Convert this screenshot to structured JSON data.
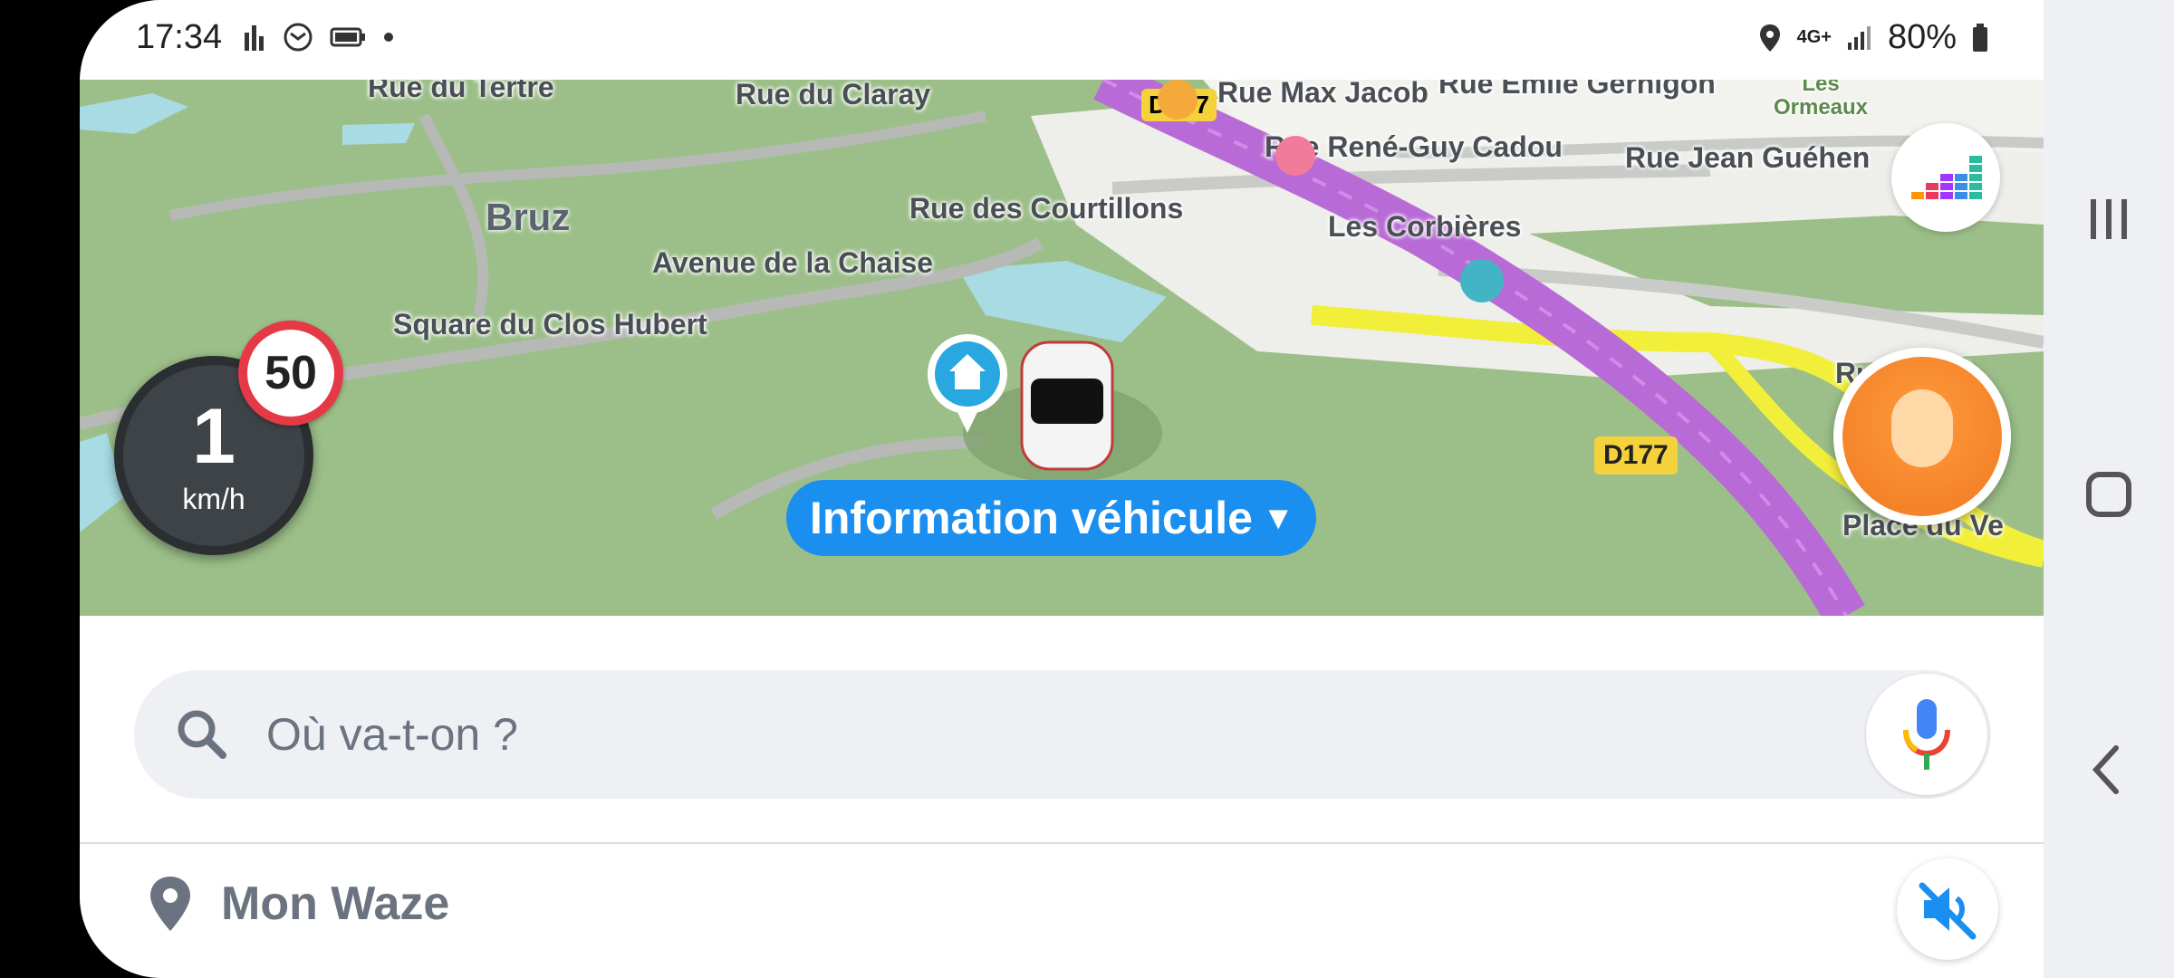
{
  "status_bar": {
    "time": "17:34",
    "battery": "80%",
    "network": "4G+",
    "left_icons": [
      "signal-bars-icon",
      "email-icon",
      "battery-saver-icon",
      "dot-icon"
    ],
    "right_icons": [
      "location-icon",
      "network-4g-icon",
      "signal-icon",
      "battery-icon"
    ]
  },
  "map": {
    "streets": [
      "Rue du Tertre",
      "Rue du Claray",
      "Rue Max Jacob",
      "Rue Emile Gernigon",
      "Rue René-Guy Cadou",
      "Rue Jean Guéhen",
      "Rue des Courtillons",
      "Les Corbières",
      "Avenue de la Chaise",
      "Square du Clos Hubert",
      "Place du Ve",
      "Rue Gavri"
    ],
    "place_name": "Bruz",
    "area_label": "Les Ormeaux",
    "road_badges": [
      "D177",
      "D177"
    ]
  },
  "speedometer": {
    "speed": "1",
    "unit": "km/h",
    "limit": "50"
  },
  "vehicle_info_label": "Information véhicule",
  "search": {
    "placeholder": "Où va-t-on ?"
  },
  "my_waze_label": "Mon Waze",
  "colors": {
    "map_green": "#9cbf89",
    "route_purple": "#b86bd6",
    "road_yellow": "#f2ef3a",
    "accent_blue": "#1a8ff0",
    "report_orange": "#f07a20"
  }
}
